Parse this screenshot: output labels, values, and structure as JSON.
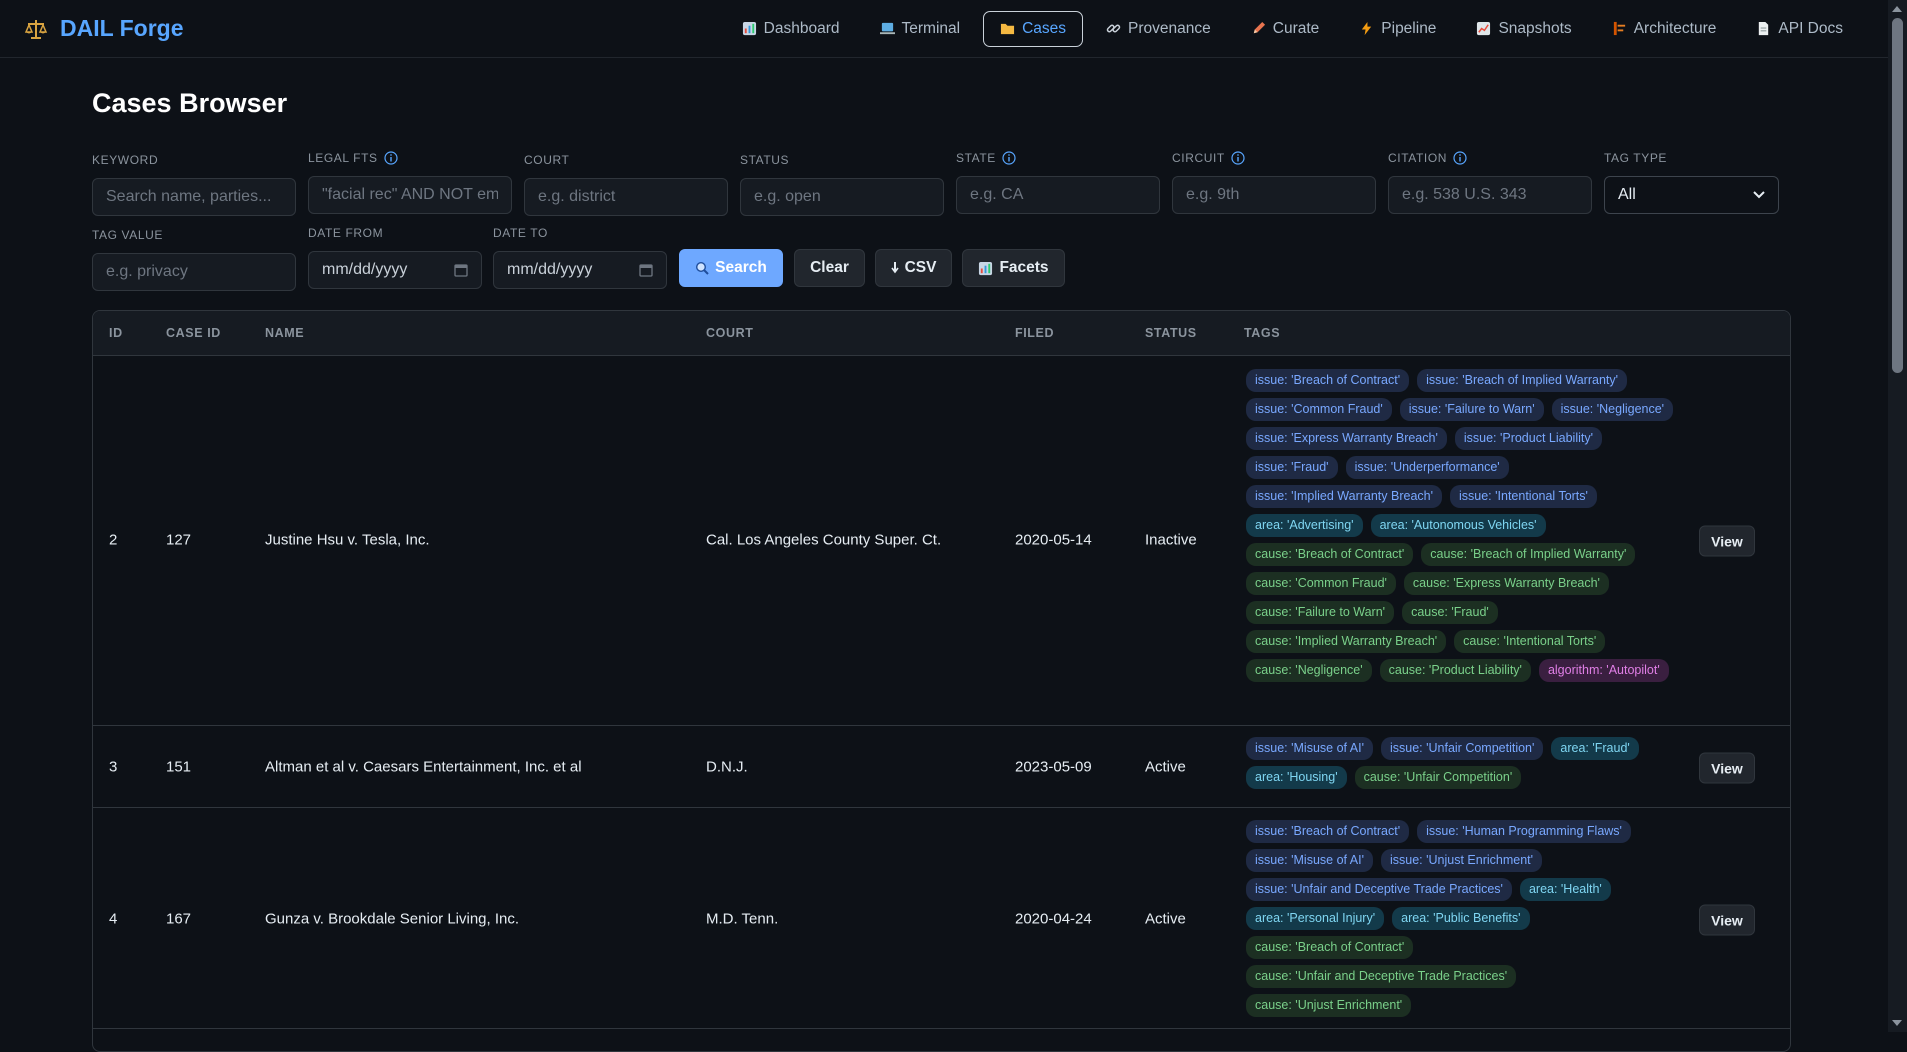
{
  "brand": {
    "title": "DAIL Forge"
  },
  "nav": [
    {
      "label": "Dashboard",
      "icon": "bar-chart-icon"
    },
    {
      "label": "Terminal",
      "icon": "laptop-icon"
    },
    {
      "label": "Cases",
      "icon": "folder-icon",
      "active": true
    },
    {
      "label": "Provenance",
      "icon": "link-icon"
    },
    {
      "label": "Curate",
      "icon": "pencil-icon"
    },
    {
      "label": "Pipeline",
      "icon": "lightning-icon"
    },
    {
      "label": "Snapshots",
      "icon": "line-chart-icon"
    },
    {
      "label": "Architecture",
      "icon": "architecture-icon"
    },
    {
      "label": "API Docs",
      "icon": "document-icon"
    }
  ],
  "page": {
    "title": "Cases Browser"
  },
  "filters": {
    "keyword": {
      "label": "KEYWORD",
      "placeholder": "Search name, parties..."
    },
    "legal_fts": {
      "label": "LEGAL FTS",
      "placeholder": "\"facial rec\" AND NOT emp"
    },
    "court": {
      "label": "COURT",
      "placeholder": "e.g. district"
    },
    "status": {
      "label": "STATUS",
      "placeholder": "e.g. open"
    },
    "state": {
      "label": "STATE",
      "placeholder": "e.g. CA"
    },
    "circuit": {
      "label": "CIRCUIT",
      "placeholder": "e.g. 9th"
    },
    "citation": {
      "label": "CITATION",
      "placeholder": "e.g. 538 U.S. 343"
    },
    "tag_type": {
      "label": "TAG TYPE",
      "value": "All"
    },
    "tag_value": {
      "label": "TAG VALUE",
      "placeholder": "e.g. privacy"
    },
    "date_from": {
      "label": "DATE FROM",
      "value": "mm/dd/yyyy"
    },
    "date_to": {
      "label": "DATE TO",
      "value": "mm/dd/yyyy"
    }
  },
  "buttons": {
    "search": "Search",
    "clear": "Clear",
    "csv": "CSV",
    "facets": "Facets"
  },
  "table": {
    "headers": {
      "id": "ID",
      "case_id": "CASE ID",
      "name": "NAME",
      "court": "COURT",
      "filed": "FILED",
      "status": "STATUS",
      "tags": "TAGS"
    },
    "view_label": "View",
    "rows": [
      {
        "id": "2",
        "case_id": "127",
        "name": "Justine Hsu v. Tesla, Inc.",
        "court": "Cal. Los Angeles County Super. Ct.",
        "filed": "2020-05-14",
        "status": "Inactive",
        "tags": [
          {
            "type": "issue",
            "text": "issue: 'Breach of Contract'"
          },
          {
            "type": "issue",
            "text": "issue: 'Breach of Implied Warranty'"
          },
          {
            "type": "issue",
            "text": "issue: 'Common Fraud'"
          },
          {
            "type": "issue",
            "text": "issue: 'Failure to Warn'"
          },
          {
            "type": "issue",
            "text": "issue: 'Negligence'"
          },
          {
            "type": "issue",
            "text": "issue: 'Express Warranty Breach'"
          },
          {
            "type": "issue",
            "text": "issue: 'Product Liability'"
          },
          {
            "type": "issue",
            "text": "issue: 'Fraud'"
          },
          {
            "type": "issue",
            "text": "issue: 'Underperformance'"
          },
          {
            "type": "issue",
            "text": "issue: 'Implied Warranty Breach'"
          },
          {
            "type": "issue",
            "text": "issue: 'Intentional Torts'"
          },
          {
            "type": "area",
            "text": "area: 'Advertising'"
          },
          {
            "type": "area",
            "text": "area: 'Autonomous Vehicles'"
          },
          {
            "type": "cause",
            "text": "cause: 'Breach of Contract'"
          },
          {
            "type": "cause",
            "text": "cause: 'Breach of Implied Warranty'"
          },
          {
            "type": "cause",
            "text": "cause: 'Common Fraud'"
          },
          {
            "type": "cause",
            "text": "cause: 'Express Warranty Breach'"
          },
          {
            "type": "cause",
            "text": "cause: 'Failure to Warn'"
          },
          {
            "type": "cause",
            "text": "cause: 'Fraud'"
          },
          {
            "type": "cause",
            "text": "cause: 'Implied Warranty Breach'"
          },
          {
            "type": "cause",
            "text": "cause: 'Intentional Torts'"
          },
          {
            "type": "cause",
            "text": "cause: 'Negligence'"
          },
          {
            "type": "cause",
            "text": "cause: 'Product Liability'"
          },
          {
            "type": "algorithm",
            "text": "algorithm: 'Autopilot'"
          }
        ]
      },
      {
        "id": "3",
        "case_id": "151",
        "name": "Altman et al v. Caesars Entertainment, Inc. et al",
        "court": "D.N.J.",
        "filed": "2023-05-09",
        "status": "Active",
        "tags": [
          {
            "type": "issue",
            "text": "issue: 'Misuse of AI'"
          },
          {
            "type": "issue",
            "text": "issue: 'Unfair Competition'"
          },
          {
            "type": "area",
            "text": "area: 'Fraud'"
          },
          {
            "type": "area",
            "text": "area: 'Housing'"
          },
          {
            "type": "cause",
            "text": "cause: 'Unfair Competition'"
          }
        ]
      },
      {
        "id": "4",
        "case_id": "167",
        "name": "Gunza v. Brookdale Senior Living, Inc.",
        "court": "M.D. Tenn.",
        "filed": "2020-04-24",
        "status": "Active",
        "tags": [
          {
            "type": "issue",
            "text": "issue: 'Breach of Contract'"
          },
          {
            "type": "issue",
            "text": "issue: 'Human Programming Flaws'"
          },
          {
            "type": "issue",
            "text": "issue: 'Misuse of AI'"
          },
          {
            "type": "issue",
            "text": "issue: 'Unjust Enrichment'"
          },
          {
            "type": "issue",
            "text": "issue: 'Unfair and Deceptive Trade Practices'"
          },
          {
            "type": "area",
            "text": "area: 'Health'"
          },
          {
            "type": "area",
            "text": "area: 'Personal Injury'"
          },
          {
            "type": "area",
            "text": "area: 'Public Benefits'"
          },
          {
            "type": "cause",
            "text": "cause: 'Breach of Contract'"
          },
          {
            "type": "cause",
            "text": "cause: 'Unfair and Deceptive Trade Practices'"
          },
          {
            "type": "cause",
            "text": "cause: 'Unjust Enrichment'"
          }
        ]
      }
    ]
  },
  "colors": {
    "accent": "#58a6ff",
    "background": "#0d1117",
    "primary_button": "#6ea8ff"
  }
}
